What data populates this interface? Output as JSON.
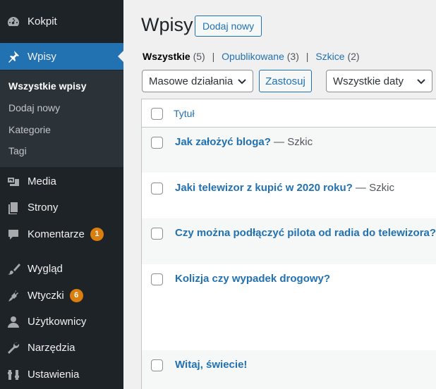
{
  "sidebar": {
    "items": [
      {
        "label": "Kokpit",
        "icon": "dashboard-icon"
      },
      {
        "label": "Wpisy",
        "icon": "pin-icon"
      },
      {
        "label": "Media",
        "icon": "media-icon"
      },
      {
        "label": "Strony",
        "icon": "page-icon"
      },
      {
        "label": "Komentarze",
        "icon": "comment-icon",
        "badge": "1"
      },
      {
        "label": "Wygląd",
        "icon": "brush-icon"
      },
      {
        "label": "Wtyczki",
        "icon": "plugin-icon",
        "badge": "6"
      },
      {
        "label": "Użytkownicy",
        "icon": "user-icon"
      },
      {
        "label": "Narzędzia",
        "icon": "wrench-icon"
      },
      {
        "label": "Ustawienia",
        "icon": "settings-icon"
      }
    ],
    "submenu": [
      "Wszystkie wpisy",
      "Dodaj nowy",
      "Kategorie",
      "Tagi"
    ]
  },
  "header": {
    "title": "Wpisy",
    "add_new": "Dodaj nowy"
  },
  "filters": {
    "all_label": "Wszystkie",
    "all_count": "(5)",
    "published_label": "Opublikowane",
    "published_count": "(3)",
    "drafts_label": "Szkice",
    "drafts_count": "(2)",
    "separator": "|"
  },
  "actions": {
    "bulk": "Masowe działania",
    "apply": "Zastosuj",
    "dates": "Wszystkie daty"
  },
  "table": {
    "col_title": "Tytuł",
    "rows": [
      {
        "title": "Jak założyć bloga?",
        "state": " — Szkic"
      },
      {
        "title": "Jaki telewizor z kupić w 2020 roku?",
        "state": " — Szkic"
      },
      {
        "title": "Czy można podłączyć pilota od radia do telewizora?",
        "state": ""
      },
      {
        "title": "Kolizja czy wypadek drogowy?",
        "state": ""
      },
      {
        "title": "Witaj, świecie!",
        "state": ""
      }
    ]
  },
  "colors": {
    "sidebar": "#1d2327",
    "accent": "#2271b1",
    "badge": "#db7e10"
  }
}
